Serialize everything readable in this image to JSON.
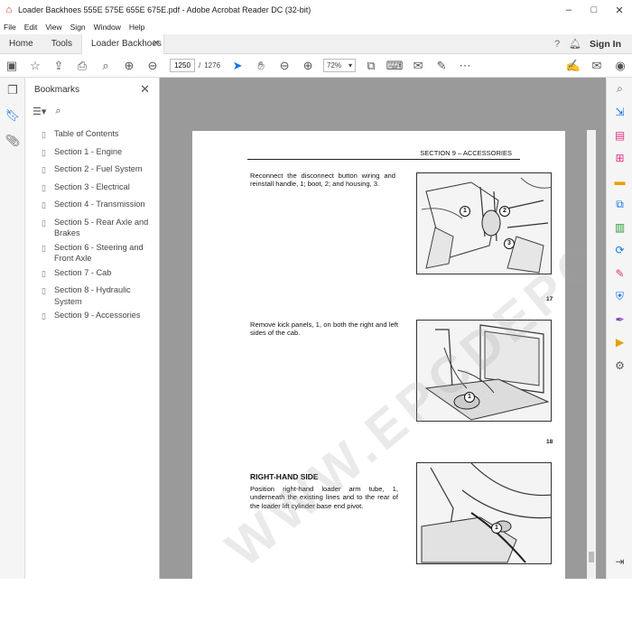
{
  "window": {
    "title": "Loader Backhoes 555E 575E 655E 675E.pdf - Adobe Acrobat Reader DC (32-bit)",
    "minimize": "–",
    "maximize": "□",
    "close": "✕"
  },
  "menu": [
    "File",
    "Edit",
    "View",
    "Sign",
    "Window",
    "Help"
  ],
  "tabs": {
    "home": "Home",
    "tools": "Tools",
    "document": "Loader Backhoes 5...",
    "signin": "Sign In"
  },
  "toolbar": {
    "page_current": "1250",
    "page_separator": "/",
    "page_total": "1276",
    "zoom": "72%"
  },
  "bookmarks": {
    "title": "Bookmarks",
    "items": [
      "Table of Contents",
      "Section 1 - Engine",
      "Section 2 - Fuel System",
      "Section 3 - Electrical",
      "Section 4 - Transmission",
      "Section 5 - Rear Axle and Brakes",
      "Section 6 - Steering and Front Axle",
      "Section 7 - Cab",
      "Section 8 - Hydraulic System",
      "Section 9 - Accessories"
    ]
  },
  "page": {
    "header": "SECTION 9 – ACCESSORIES",
    "para1": "Reconnect the disconnect button wiring and reinstall handle, 1; boot, 2; and housing, 3.",
    "fig1_num": "17",
    "para2": "Remove kick panels, 1, on both the right and left sides of the cab.",
    "fig2_num": "18",
    "heading3": "RIGHT-HAND SIDE",
    "para3": "Position right-hand loader arm tube, 1, underneath the existing lines and to the rear of the loader lift cylinder base end pivot.",
    "callouts": {
      "a": "1",
      "b": "2",
      "c": "3",
      "d": "1",
      "e": "1"
    },
    "watermark": "WWW.EPCDEPOT.COM"
  },
  "colors": {
    "accent": "#1473e6",
    "canvas": "#9a9a9a"
  }
}
